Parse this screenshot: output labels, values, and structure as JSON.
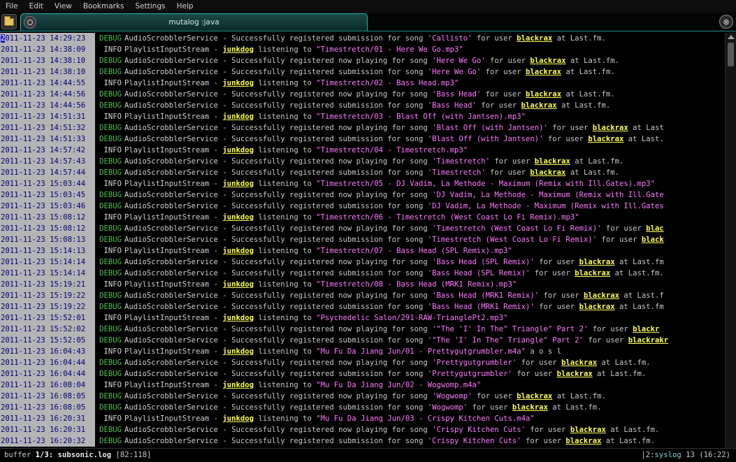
{
  "menu": [
    "File",
    "Edit",
    "View",
    "Bookmarks",
    "Settings",
    "Help"
  ],
  "tab": {
    "title": "mutalog :java"
  },
  "log": [
    {
      "ts": "2011-11-23 14:29:23",
      "level": "DEBUG",
      "svc": "AudioScrobblerService",
      "pre": " - Successfully registered submission for song ",
      "song": "'Callisto'",
      "mid": " for user ",
      "user": "blackrax",
      "post": " at Last.fm."
    },
    {
      "ts": "2011-11-23 14:38:09",
      "level": "INFO",
      "svc": "PlaylistInputStream",
      "pre": " - ",
      "user": "junkdog",
      "mid": " listening to ",
      "song": "\"Timestretch/01 - Here We Go.mp3\"",
      "post": "",
      "order": "user-first"
    },
    {
      "ts": "2011-11-23 14:38:10",
      "level": "DEBUG",
      "svc": "AudioScrobblerService",
      "pre": " - Successfully registered now playing for song ",
      "song": "'Here We Go'",
      "mid": " for user ",
      "user": "blackrax",
      "post": " at Last.fm."
    },
    {
      "ts": "2011-11-23 14:38:10",
      "level": "DEBUG",
      "svc": "AudioScrobblerService",
      "pre": " - Successfully registered submission for song ",
      "song": "'Here We Go'",
      "mid": " for user ",
      "user": "blackrax",
      "post": " at Last.fm."
    },
    {
      "ts": "2011-11-23 14:44:55",
      "level": "INFO",
      "svc": "PlaylistInputStream",
      "pre": " - ",
      "user": "junkdog",
      "mid": " listening to ",
      "song": "\"Timestretch/02 - Bass Head.mp3\"",
      "post": "",
      "order": "user-first"
    },
    {
      "ts": "2011-11-23 14:44:56",
      "level": "DEBUG",
      "svc": "AudioScrobblerService",
      "pre": " - Successfully registered now playing for song ",
      "song": "'Bass Head'",
      "mid": " for user ",
      "user": "blackrax",
      "post": " at Last.fm."
    },
    {
      "ts": "2011-11-23 14:44:56",
      "level": "DEBUG",
      "svc": "AudioScrobblerService",
      "pre": " - Successfully registered submission for song ",
      "song": "'Bass Head'",
      "mid": " for user ",
      "user": "blackrax",
      "post": " at Last.fm."
    },
    {
      "ts": "2011-11-23 14:51:31",
      "level": "INFO",
      "svc": "PlaylistInputStream",
      "pre": " - ",
      "user": "junkdog",
      "mid": " listening to ",
      "song": "\"Timestretch/03 - Blast Off (with Jantsen).mp3\"",
      "post": "",
      "order": "user-first"
    },
    {
      "ts": "2011-11-23 14:51:32",
      "level": "DEBUG",
      "svc": "AudioScrobblerService",
      "pre": " - Successfully registered now playing for song ",
      "song": "'Blast Off (with Jantsen)'",
      "mid": " for user ",
      "user": "blackrax",
      "post": " at Last"
    },
    {
      "ts": "2011-11-23 14:51:33",
      "level": "DEBUG",
      "svc": "AudioScrobblerService",
      "pre": " - Successfully registered submission for song ",
      "song": "'Blast Off (with Jantsen)'",
      "mid": " for user ",
      "user": "blackrax",
      "post": " at Last."
    },
    {
      "ts": "2011-11-23 14:57:42",
      "level": "INFO",
      "svc": "PlaylistInputStream",
      "pre": " - ",
      "user": "junkdog",
      "mid": " listening to ",
      "song": "\"Timestretch/04 - Timestretch.mp3\"",
      "post": "",
      "order": "user-first"
    },
    {
      "ts": "2011-11-23 14:57:43",
      "level": "DEBUG",
      "svc": "AudioScrobblerService",
      "pre": " - Successfully registered now playing for song ",
      "song": "'Timestretch'",
      "mid": " for user ",
      "user": "blackrax",
      "post": " at Last.fm."
    },
    {
      "ts": "2011-11-23 14:57:44",
      "level": "DEBUG",
      "svc": "AudioScrobblerService",
      "pre": " - Successfully registered submission for song ",
      "song": "'Timestretch'",
      "mid": " for user ",
      "user": "blackrax",
      "post": " at Last.fm."
    },
    {
      "ts": "2011-11-23 15:03:44",
      "level": "INFO",
      "svc": "PlaylistInputStream",
      "pre": " - ",
      "user": "junkdog",
      "mid": " listening to ",
      "song": "\"Timestretch/05 - DJ Vadim, La Methode - Maximum (Remix with Ill.Gates).mp3\"",
      "post": "",
      "order": "user-first"
    },
    {
      "ts": "2011-11-23 15:03:45",
      "level": "DEBUG",
      "svc": "AudioScrobblerService",
      "pre": " - Successfully registered now playing for song ",
      "song": "'DJ Vadim, La Methode - Maximum (Remix with Ill.Gate",
      "mid": "",
      "user": "",
      "post": ""
    },
    {
      "ts": "2011-11-23 15:03:46",
      "level": "DEBUG",
      "svc": "AudioScrobblerService",
      "pre": " - Successfully registered submission for song ",
      "song": "'DJ Vadim, La Methode - Maximum (Remix with Ill.Gates",
      "mid": "",
      "user": "",
      "post": ""
    },
    {
      "ts": "2011-11-23 15:08:12",
      "level": "INFO",
      "svc": "PlaylistInputStream",
      "pre": " - ",
      "user": "junkdog",
      "mid": " listening to ",
      "song": "\"Timestretch/06 - Timestretch (West Coast Lo Fi Remix).mp3\"",
      "post": "",
      "order": "user-first"
    },
    {
      "ts": "2011-11-23 15:08:12",
      "level": "DEBUG",
      "svc": "AudioScrobblerService",
      "pre": " - Successfully registered now playing for song ",
      "song": "'Timestretch (West Coast Lo Fi Remix)'",
      "mid": " for user ",
      "user": "blac",
      "post": ""
    },
    {
      "ts": "2011-11-23 15:08:13",
      "level": "DEBUG",
      "svc": "AudioScrobblerService",
      "pre": " - Successfully registered submission for song ",
      "song": "'Timestretch (West Coast Lo Fi Remix)'",
      "mid": " for user ",
      "user": "black",
      "post": ""
    },
    {
      "ts": "2011-11-23 15:14:13",
      "level": "INFO",
      "svc": "PlaylistInputStream",
      "pre": " - ",
      "user": "junkdog",
      "mid": " listening to ",
      "song": "\"Timestretch/07 - Bass Head (SPL Remix).mp3\"",
      "post": "",
      "order": "user-first"
    },
    {
      "ts": "2011-11-23 15:14:14",
      "level": "DEBUG",
      "svc": "AudioScrobblerService",
      "pre": " - Successfully registered now playing for song ",
      "song": "'Bass Head (SPL Remix)'",
      "mid": " for user ",
      "user": "blackrax",
      "post": " at Last.fm"
    },
    {
      "ts": "2011-11-23 15:14:14",
      "level": "DEBUG",
      "svc": "AudioScrobblerService",
      "pre": " - Successfully registered submission for song ",
      "song": "'Bass Head (SPL Remix)'",
      "mid": " for user ",
      "user": "blackrax",
      "post": " at Last.fm."
    },
    {
      "ts": "2011-11-23 15:19:21",
      "level": "INFO",
      "svc": "PlaylistInputStream",
      "pre": " - ",
      "user": "junkdog",
      "mid": " listening to ",
      "song": "\"Timestretch/08 - Bass Head (MRK1 Remix).mp3\"",
      "post": "",
      "order": "user-first"
    },
    {
      "ts": "2011-11-23 15:19:22",
      "level": "DEBUG",
      "svc": "AudioScrobblerService",
      "pre": " - Successfully registered now playing for song ",
      "song": "'Bass Head (MRK1 Remix)'",
      "mid": " for user ",
      "user": "blackrax",
      "post": " at Last.f"
    },
    {
      "ts": "2011-11-23 15:19:22",
      "level": "DEBUG",
      "svc": "AudioScrobblerService",
      "pre": " - Successfully registered submission for song ",
      "song": "'Bass Head (MRK1 Remix)'",
      "mid": " for user ",
      "user": "blackrax",
      "post": " at Last.fm"
    },
    {
      "ts": "2011-11-23 15:52:01",
      "level": "INFO",
      "svc": "PlaylistInputStream",
      "pre": " - ",
      "user": "junkdog",
      "mid": " listening to ",
      "song": "\"Psychedelic Salon/291-RAW-TrianglePt2.mp3\"",
      "post": "",
      "order": "user-first"
    },
    {
      "ts": "2011-11-23 15:52:02",
      "level": "DEBUG",
      "svc": "AudioScrobblerService",
      "pre": " - Successfully registered now playing for song ",
      "song": "'\"The 'I' In The\" Triangle\"  Part 2'",
      "mid": " for user ",
      "user": "blackr",
      "post": ""
    },
    {
      "ts": "2011-11-23 15:52:05",
      "level": "DEBUG",
      "svc": "AudioScrobblerService",
      "pre": " - Successfully registered submission for song ",
      "song": "'\"The 'I' In The\" Triangle\" Part 2'",
      "mid": " for user ",
      "user": "blackrakr",
      "post": ""
    },
    {
      "ts": "2011-11-23 16:04:43",
      "level": "INFO",
      "svc": "PlaylistInputStream",
      "pre": " - ",
      "user": "junkdog",
      "mid": " listening to ",
      "song": "\"Mu Fu Da Jiang Jun/01 - Prettygutgrumbler.m4a\"",
      "post": "      a      o     s     l",
      "order": "user-first"
    },
    {
      "ts": "2011-11-23 16:04:44",
      "level": "DEBUG",
      "svc": "AudioScrobblerService",
      "pre": " - Successfully registered now playing for song ",
      "song": "'Prettygutgrumbler'",
      "mid": " for user ",
      "user": "blackrax",
      "post": " at Last.fm."
    },
    {
      "ts": "2011-11-23 16:04:44",
      "level": "DEBUG",
      "svc": "AudioScrobblerService",
      "pre": " - Successfully registered submission for song ",
      "song": "'Prettygutgrumbler'",
      "mid": " for user ",
      "user": "blackrax",
      "post": " at Last.fm."
    },
    {
      "ts": "2011-11-23 16:08:04",
      "level": "INFO",
      "svc": "PlaylistInputStream",
      "pre": " - ",
      "user": "junkdog",
      "mid": " listening to ",
      "song": "\"Mu Fu Da Jiang Jun/02 - Wogwomp.m4a\"",
      "post": "",
      "order": "user-first"
    },
    {
      "ts": "2011-11-23 16:08:05",
      "level": "DEBUG",
      "svc": "AudioScrobblerService",
      "pre": " - Successfully registered now playing for song ",
      "song": "'Wogwomp'",
      "mid": " for user ",
      "user": "blackrax",
      "post": " at Last.fm."
    },
    {
      "ts": "2011-11-23 16:08:05",
      "level": "DEBUG",
      "svc": "AudioScrobblerService",
      "pre": " - Successfully registered submission for song ",
      "song": "'Wogwomp'",
      "mid": " for user ",
      "user": "blackrax",
      "post": " at Last.fm."
    },
    {
      "ts": "2011-11-23 16:20:31",
      "level": "INFO",
      "svc": "PlaylistInputStream",
      "pre": " - ",
      "user": "junkdog",
      "mid": " listening to ",
      "song": "\"Mu Fu Da Jiang Jun/03 - Crispy Kitchen Cuts.m4a\"",
      "post": "",
      "order": "user-first"
    },
    {
      "ts": "2011-11-23 16:20:31",
      "level": "DEBUG",
      "svc": "AudioScrobblerService",
      "pre": " - Successfully registered now playing for song ",
      "song": "'Crispy Kitchen Cuts'",
      "mid": " for user ",
      "user": "blackrax",
      "post": " at Last.fm."
    },
    {
      "ts": "2011-11-23 16:20:32",
      "level": "DEBUG",
      "svc": "AudioScrobblerService",
      "pre": " - Successfully registered submission for song ",
      "song": "'Crispy Kitchen Cuts'",
      "mid": " for user ",
      "user": "blackrax",
      "post": " at Last.fm."
    }
  ],
  "status": {
    "buffer_label": "buffer",
    "buffer_index": "1/3:",
    "filename": "subsonic.log",
    "position": "[82:118]",
    "right_prefix": "|2:",
    "right_name": "syslog",
    "right_count": "13",
    "right_time": "(16:22)"
  },
  "colors": {
    "timestamp_bg": "#b4b4b4",
    "debug": "#4ec04e",
    "song": "#ff78ff",
    "user": "#ffff50",
    "tab_border": "#2ab0aa"
  }
}
